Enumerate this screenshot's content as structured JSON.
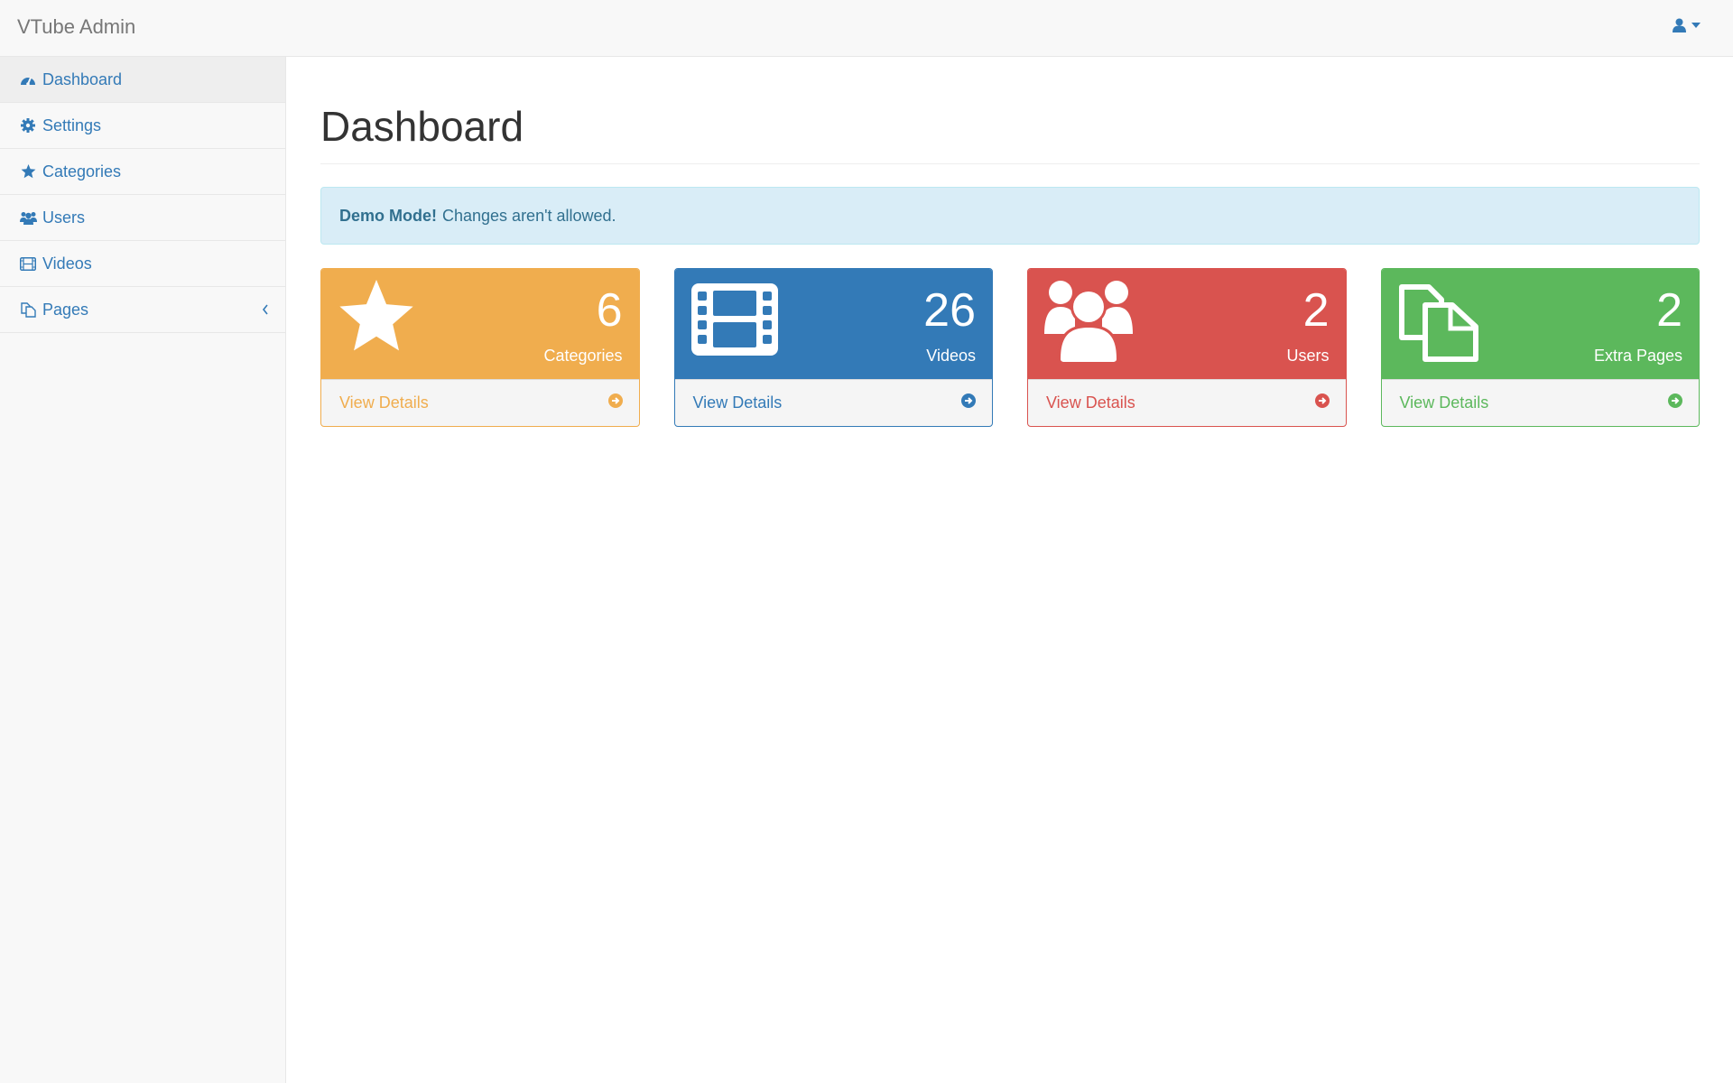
{
  "app": {
    "title": "VTube Admin"
  },
  "header": {
    "user_icon": "user-icon",
    "dropdown_icon": "caret-down-icon"
  },
  "sidebar": {
    "items": [
      {
        "label": "Dashboard",
        "icon": "dashboard-icon",
        "active": true
      },
      {
        "label": "Settings",
        "icon": "gear-icon"
      },
      {
        "label": "Categories",
        "icon": "star-icon"
      },
      {
        "label": "Users",
        "icon": "users-icon"
      },
      {
        "label": "Videos",
        "icon": "film-icon"
      },
      {
        "label": "Pages",
        "icon": "files-icon",
        "expand_icon": "chevron-left-icon"
      }
    ]
  },
  "main": {
    "title": "Dashboard",
    "alert": {
      "strong": "Demo Mode!",
      "text": "Changes aren't allowed."
    },
    "cards": [
      {
        "count": "6",
        "label": "Categories",
        "link": "View Details",
        "icon": "star-icon",
        "color": "#f0ad4e"
      },
      {
        "count": "26",
        "label": "Videos",
        "link": "View Details",
        "icon": "film-icon",
        "color": "#337ab7"
      },
      {
        "count": "2",
        "label": "Users",
        "link": "View Details",
        "icon": "users-icon",
        "color": "#d9534f"
      },
      {
        "count": "2",
        "label": "Extra Pages",
        "link": "View Details",
        "icon": "files-icon",
        "color": "#5cb85c"
      }
    ]
  },
  "colors": {
    "link": "#337ab7",
    "alert_bg": "#d9edf7",
    "alert_text": "#31708f"
  }
}
